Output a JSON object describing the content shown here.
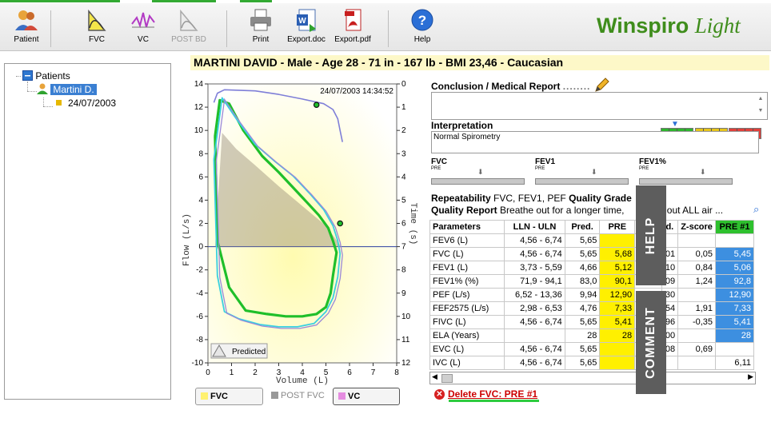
{
  "toolbar": {
    "buttons": [
      {
        "label": "Patient",
        "icon": "patient-icon"
      },
      {
        "label": "FVC",
        "icon": "fvc-icon"
      },
      {
        "label": "VC",
        "icon": "vc-icon"
      },
      {
        "label": "POST BD",
        "icon": "post-bd-icon"
      },
      {
        "label": "Print",
        "icon": "printer-icon"
      },
      {
        "label": "Export.doc",
        "icon": "word-doc-icon"
      },
      {
        "label": "Export.pdf",
        "icon": "pdf-icon"
      },
      {
        "label": "Help",
        "icon": "help-icon"
      }
    ]
  },
  "brand": {
    "name": "Winspiro",
    "edition": "Light"
  },
  "tree": {
    "root": "Patients",
    "patient": "Martini D.",
    "session": "24/07/2003"
  },
  "header": {
    "patient_line": "MARTINI DAVID - Male - Age 28 - 71 in - 167 lb - BMI 23,46 - Caucasian"
  },
  "chart": {
    "timestamp": "24/07/2003 14:34:52",
    "ylabel": "Flow (L/s)",
    "xlabel": "Volume (L)",
    "y2label": "Time (s)",
    "y_ticks": [
      "14",
      "12",
      "10",
      "8",
      "6",
      "4",
      "2",
      "0",
      "-2",
      "-4",
      "-6",
      "-8",
      "-10"
    ],
    "x_ticks": [
      "0",
      "1",
      "2",
      "3",
      "4",
      "5",
      "6",
      "7",
      "8"
    ],
    "y2_ticks": [
      "0",
      "1",
      "2",
      "3",
      "4",
      "5",
      "6",
      "7",
      "8",
      "9",
      "10",
      "11",
      "12"
    ],
    "predicted_label": "Predicted"
  },
  "chart_data": {
    "type": "line",
    "xlabel": "Volume (L)",
    "ylabel": "Flow (L/s)",
    "xlim": [
      0,
      8
    ],
    "ylim": [
      -10,
      14
    ],
    "series": [
      {
        "name": "Predicted",
        "x": [
          0.3,
          0.6,
          1.2,
          2.0,
          3.0,
          4.0,
          5.0,
          5.65
        ],
        "y": [
          0,
          9.8,
          8.4,
          7.0,
          5.2,
          3.5,
          1.8,
          0
        ]
      },
      {
        "x": [
          0.3,
          0.5,
          0.9,
          1.5,
          2.3,
          3.0,
          3.6,
          4.2,
          4.7,
          5.1,
          5.3,
          5.45,
          5.3,
          5.2,
          5.0,
          4.6,
          4.0,
          3.3,
          2.5,
          1.6,
          0.9,
          0.4,
          0.3
        ],
        "y": [
          9.5,
          12.6,
          12.3,
          10.0,
          7.8,
          6.4,
          5.1,
          3.8,
          2.7,
          1.6,
          0.5,
          -0.5,
          -2.5,
          -4.0,
          -5.2,
          -5.8,
          -6.0,
          -6.0,
          -5.8,
          -5.5,
          -3.5,
          0.5,
          9.5
        ]
      },
      {
        "x": [
          0.25,
          0.6,
          1.2,
          2.0,
          2.8,
          3.6,
          4.3,
          4.9,
          5.3,
          5.5,
          5.6,
          5.5,
          5.3,
          5.0,
          4.5,
          3.8,
          3.0,
          2.2,
          1.3,
          0.7,
          0.4,
          0.25
        ],
        "y": [
          7.5,
          12.8,
          11.0,
          8.8,
          7.4,
          6.1,
          4.6,
          3.2,
          1.8,
          0.5,
          -0.6,
          -2.6,
          -4.4,
          -5.6,
          -6.6,
          -6.9,
          -6.9,
          -6.7,
          -6.2,
          -5.6,
          -2.5,
          7.5
        ]
      },
      {
        "x": [
          0.25,
          0.4,
          0.7,
          2.0,
          3.0,
          4.0,
          4.9,
          5.3,
          5.5,
          5.6,
          5.7
        ],
        "y": [
          12.4,
          13.2,
          13.5,
          13.4,
          13.1,
          12.7,
          12.3,
          11.8,
          11.0,
          10.0,
          9.0
        ]
      }
    ],
    "points": [
      {
        "x": 0.9,
        "y": -8.7
      },
      {
        "x": 4.6,
        "y": 12.2
      },
      {
        "x": 5.6,
        "y": 2.0
      }
    ]
  },
  "legend_buttons": {
    "fvc": "FVC",
    "post_fvc": "POST FVC",
    "vc": "VC"
  },
  "conclusion": {
    "title": "Conclusion / Medical Report",
    "value": ""
  },
  "interpretation": {
    "title": "Interpretation",
    "value": "Normal Spirometry"
  },
  "grades": {
    "colors": [
      "#2db52d",
      "#e6c41a",
      "#e0403a"
    ]
  },
  "param_bars": [
    {
      "title": "FVC",
      "pre": "PRE"
    },
    {
      "title": "FEV1",
      "pre": "PRE"
    },
    {
      "title": "FEV1%",
      "pre": "PRE"
    }
  ],
  "repeatability": {
    "label": "Repeatability",
    "value": "FVC, FEV1, PEF",
    "grade_label": "Quality Grade",
    "report_label": "Quality Report",
    "report_value": "Breathe out for a longer time,",
    "report_value_tail": "e out ALL air ..."
  },
  "table": {
    "headers": [
      "Parameters",
      "LLN - ULN",
      "Pred.",
      "PRE",
      "",
      "d.",
      "Z-score",
      "PRE #1"
    ],
    "rows": [
      [
        "FEV6 (L)",
        "4,56 - 6,74",
        "5,65",
        "",
        "",
        "",
        "",
        ""
      ],
      [
        "FVC (L)",
        "4,56 - 6,74",
        "5,65",
        "5,68",
        "",
        "01",
        "0,05",
        "5,45"
      ],
      [
        "FEV1 (L)",
        "3,73 - 5,59",
        "4,66",
        "5,12",
        "",
        "10",
        "0,84",
        "5,06"
      ],
      [
        "FEV1% (%)",
        "71,9 - 94,1",
        "83,0",
        "90,1",
        "",
        "09",
        "1,24",
        "92,8"
      ],
      [
        "PEF (L/s)",
        "6,52 - 13,36",
        "9,94",
        "12,90",
        "",
        "30",
        "",
        "12,90"
      ],
      [
        "FEF2575 (L/s)",
        "2,98 - 6,53",
        "4,76",
        "7,33",
        "",
        "54",
        "1,91",
        "7,33"
      ],
      [
        "FIVC (L)",
        "4,56 - 6,74",
        "5,65",
        "5,41",
        "",
        "96",
        "-0,35",
        "5,41"
      ],
      [
        "ELA (Years)",
        "",
        "28",
        "28",
        "",
        "00",
        "",
        "28"
      ],
      [
        "EVC (L)",
        "4,56 - 6,74",
        "5,65",
        "",
        "",
        "08",
        "0,69",
        ""
      ],
      [
        "IVC (L)",
        "4,56 - 6,74",
        "5,65",
        "",
        "",
        "",
        "",
        "6,11"
      ]
    ]
  },
  "side_tabs": {
    "help": "HELP",
    "comment": "COMMENT"
  },
  "delete": {
    "label": "Delete FVC: PRE #1"
  }
}
